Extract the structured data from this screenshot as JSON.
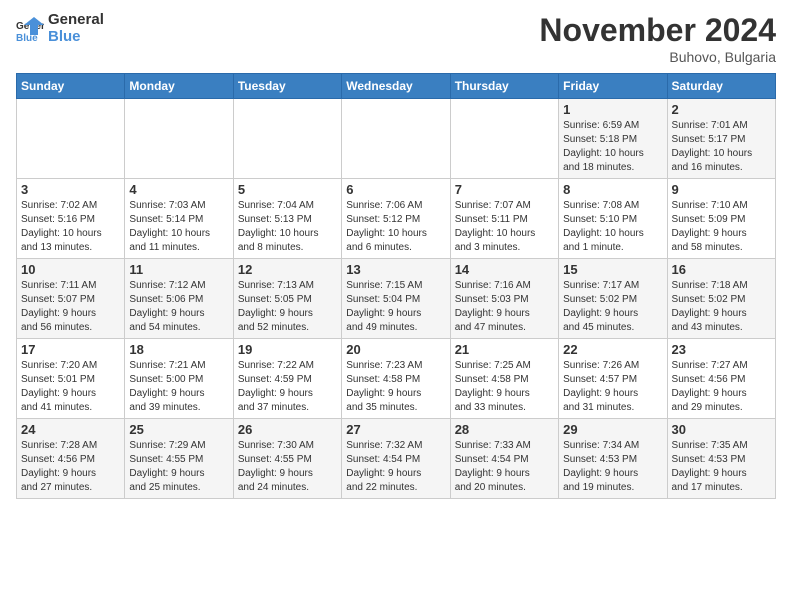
{
  "logo": {
    "line1": "General",
    "line2": "Blue"
  },
  "title": "November 2024",
  "location": "Buhovo, Bulgaria",
  "days_header": [
    "Sunday",
    "Monday",
    "Tuesday",
    "Wednesday",
    "Thursday",
    "Friday",
    "Saturday"
  ],
  "weeks": [
    [
      {
        "day": "",
        "info": ""
      },
      {
        "day": "",
        "info": ""
      },
      {
        "day": "",
        "info": ""
      },
      {
        "day": "",
        "info": ""
      },
      {
        "day": "",
        "info": ""
      },
      {
        "day": "1",
        "info": "Sunrise: 6:59 AM\nSunset: 5:18 PM\nDaylight: 10 hours\nand 18 minutes."
      },
      {
        "day": "2",
        "info": "Sunrise: 7:01 AM\nSunset: 5:17 PM\nDaylight: 10 hours\nand 16 minutes."
      }
    ],
    [
      {
        "day": "3",
        "info": "Sunrise: 7:02 AM\nSunset: 5:16 PM\nDaylight: 10 hours\nand 13 minutes."
      },
      {
        "day": "4",
        "info": "Sunrise: 7:03 AM\nSunset: 5:14 PM\nDaylight: 10 hours\nand 11 minutes."
      },
      {
        "day": "5",
        "info": "Sunrise: 7:04 AM\nSunset: 5:13 PM\nDaylight: 10 hours\nand 8 minutes."
      },
      {
        "day": "6",
        "info": "Sunrise: 7:06 AM\nSunset: 5:12 PM\nDaylight: 10 hours\nand 6 minutes."
      },
      {
        "day": "7",
        "info": "Sunrise: 7:07 AM\nSunset: 5:11 PM\nDaylight: 10 hours\nand 3 minutes."
      },
      {
        "day": "8",
        "info": "Sunrise: 7:08 AM\nSunset: 5:10 PM\nDaylight: 10 hours\nand 1 minute."
      },
      {
        "day": "9",
        "info": "Sunrise: 7:10 AM\nSunset: 5:09 PM\nDaylight: 9 hours\nand 58 minutes."
      }
    ],
    [
      {
        "day": "10",
        "info": "Sunrise: 7:11 AM\nSunset: 5:07 PM\nDaylight: 9 hours\nand 56 minutes."
      },
      {
        "day": "11",
        "info": "Sunrise: 7:12 AM\nSunset: 5:06 PM\nDaylight: 9 hours\nand 54 minutes."
      },
      {
        "day": "12",
        "info": "Sunrise: 7:13 AM\nSunset: 5:05 PM\nDaylight: 9 hours\nand 52 minutes."
      },
      {
        "day": "13",
        "info": "Sunrise: 7:15 AM\nSunset: 5:04 PM\nDaylight: 9 hours\nand 49 minutes."
      },
      {
        "day": "14",
        "info": "Sunrise: 7:16 AM\nSunset: 5:03 PM\nDaylight: 9 hours\nand 47 minutes."
      },
      {
        "day": "15",
        "info": "Sunrise: 7:17 AM\nSunset: 5:02 PM\nDaylight: 9 hours\nand 45 minutes."
      },
      {
        "day": "16",
        "info": "Sunrise: 7:18 AM\nSunset: 5:02 PM\nDaylight: 9 hours\nand 43 minutes."
      }
    ],
    [
      {
        "day": "17",
        "info": "Sunrise: 7:20 AM\nSunset: 5:01 PM\nDaylight: 9 hours\nand 41 minutes."
      },
      {
        "day": "18",
        "info": "Sunrise: 7:21 AM\nSunset: 5:00 PM\nDaylight: 9 hours\nand 39 minutes."
      },
      {
        "day": "19",
        "info": "Sunrise: 7:22 AM\nSunset: 4:59 PM\nDaylight: 9 hours\nand 37 minutes."
      },
      {
        "day": "20",
        "info": "Sunrise: 7:23 AM\nSunset: 4:58 PM\nDaylight: 9 hours\nand 35 minutes."
      },
      {
        "day": "21",
        "info": "Sunrise: 7:25 AM\nSunset: 4:58 PM\nDaylight: 9 hours\nand 33 minutes."
      },
      {
        "day": "22",
        "info": "Sunrise: 7:26 AM\nSunset: 4:57 PM\nDaylight: 9 hours\nand 31 minutes."
      },
      {
        "day": "23",
        "info": "Sunrise: 7:27 AM\nSunset: 4:56 PM\nDaylight: 9 hours\nand 29 minutes."
      }
    ],
    [
      {
        "day": "24",
        "info": "Sunrise: 7:28 AM\nSunset: 4:56 PM\nDaylight: 9 hours\nand 27 minutes."
      },
      {
        "day": "25",
        "info": "Sunrise: 7:29 AM\nSunset: 4:55 PM\nDaylight: 9 hours\nand 25 minutes."
      },
      {
        "day": "26",
        "info": "Sunrise: 7:30 AM\nSunset: 4:55 PM\nDaylight: 9 hours\nand 24 minutes."
      },
      {
        "day": "27",
        "info": "Sunrise: 7:32 AM\nSunset: 4:54 PM\nDaylight: 9 hours\nand 22 minutes."
      },
      {
        "day": "28",
        "info": "Sunrise: 7:33 AM\nSunset: 4:54 PM\nDaylight: 9 hours\nand 20 minutes."
      },
      {
        "day": "29",
        "info": "Sunrise: 7:34 AM\nSunset: 4:53 PM\nDaylight: 9 hours\nand 19 minutes."
      },
      {
        "day": "30",
        "info": "Sunrise: 7:35 AM\nSunset: 4:53 PM\nDaylight: 9 hours\nand 17 minutes."
      }
    ]
  ]
}
